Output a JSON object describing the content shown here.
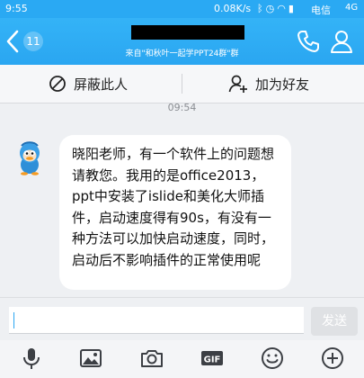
{
  "status_bar": {
    "time": "9:55",
    "speed": "0.08K/s",
    "carrier": "电信",
    "network": "4G"
  },
  "header": {
    "unread_count": "11",
    "subtitle": "来自\"和秋叶一起学PPT24群\"群"
  },
  "actions": {
    "block_label": "屏蔽此人",
    "add_friend_label": "加为好友"
  },
  "chat": {
    "timestamp": "09:54",
    "message": "晓阳老师，有一个软件上的问题想请教您。我用的是office2013，ppt中安装了islide和美化大师插件，启动速度得有90s，有没有一种方法可以加快启动速度，同时，启动后不影响插件的正常使用呢"
  },
  "input": {
    "send_label": "发送"
  },
  "colors": {
    "accent": "#2aa6f1",
    "background": "#eef0f3"
  }
}
